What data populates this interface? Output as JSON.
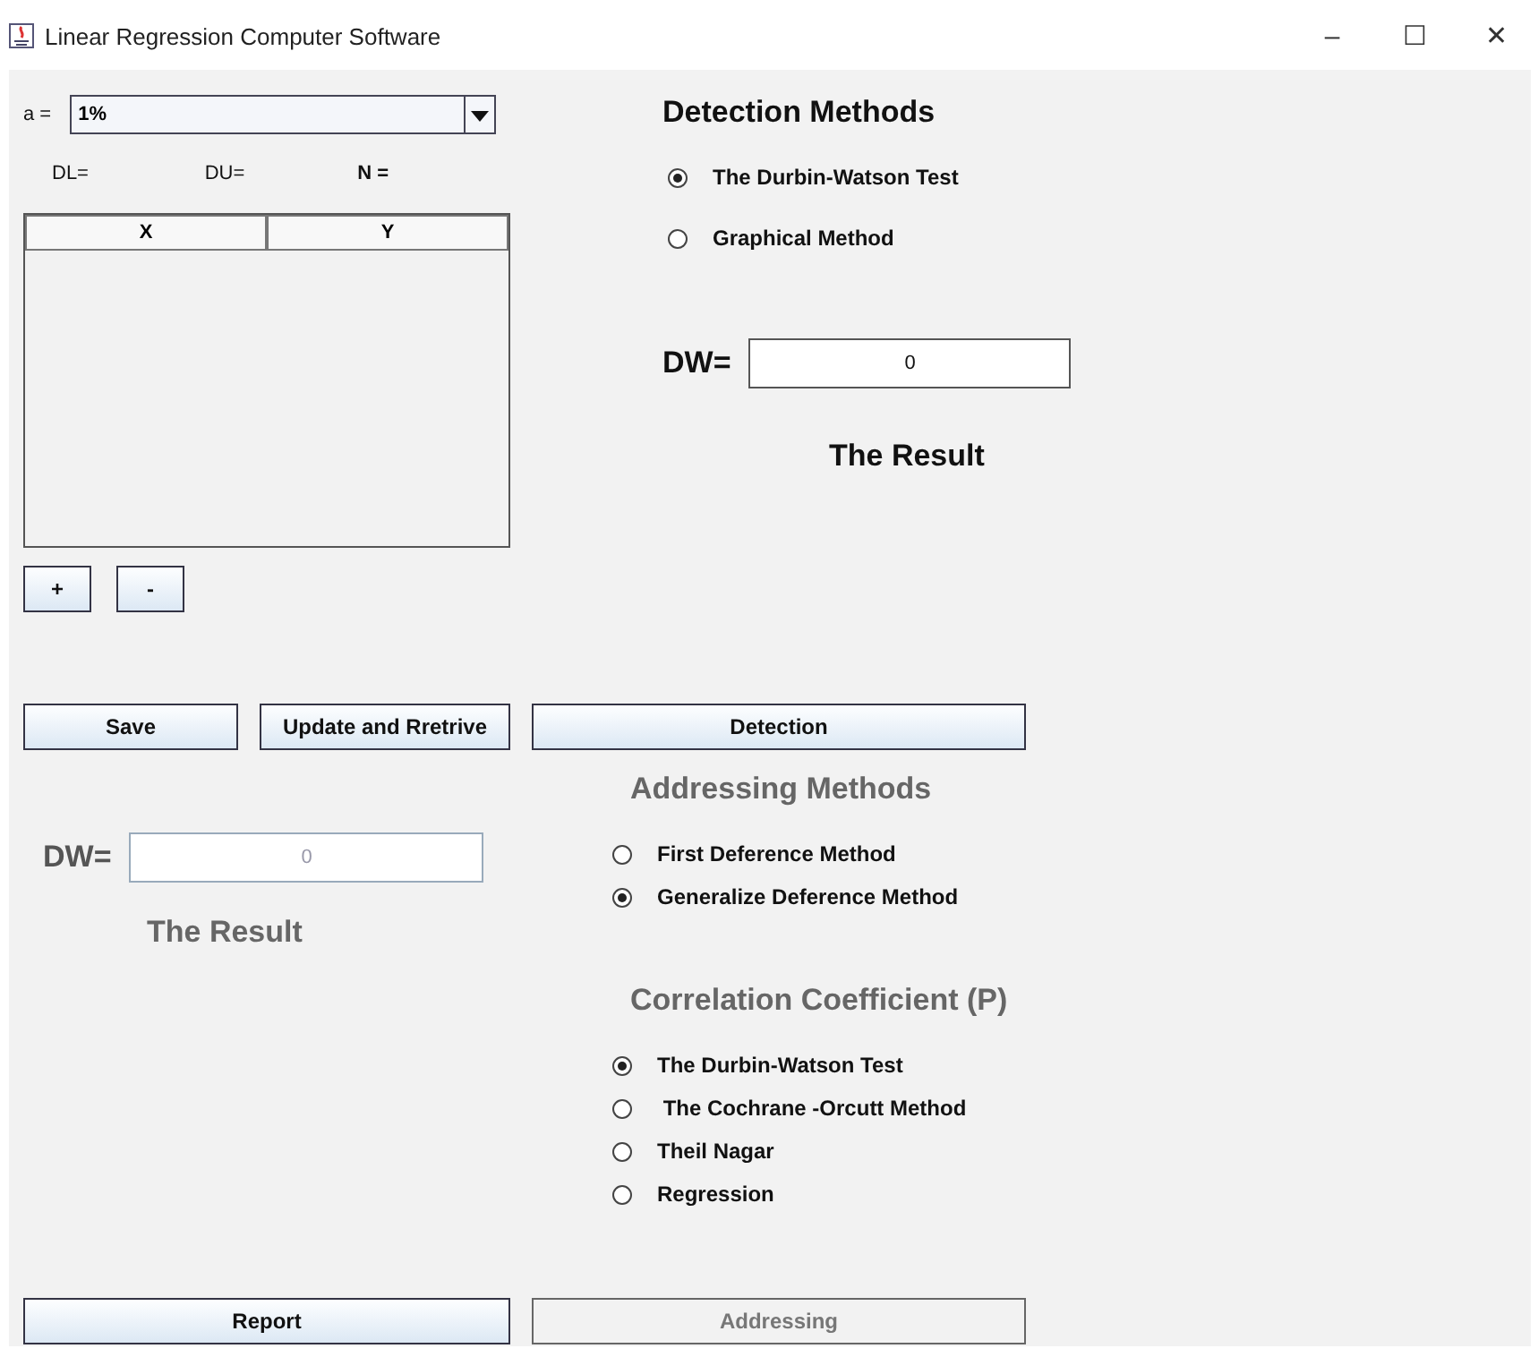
{
  "window": {
    "title": "Linear Regression Computer Software",
    "controls": [
      "–",
      "☐",
      "✕"
    ]
  },
  "alpha": {
    "label": "a =",
    "value": "1%"
  },
  "stats": [
    "DL=",
    "DU=",
    "N ="
  ],
  "table": {
    "columns": [
      "X",
      "Y"
    ]
  },
  "row_buttons": [
    "+",
    "-"
  ],
  "detection": {
    "title": "Detection Methods",
    "options": [
      {
        "label": "The Durbin-Watson Test",
        "selected": true
      },
      {
        "label": "Graphical Method",
        "selected": false
      }
    ],
    "dw_label": "DW=",
    "dw_value": "0",
    "result": "The Result"
  },
  "action_buttons": [
    {
      "label": "Save",
      "disabled": false
    },
    {
      "label": "Update and Rretrive",
      "disabled": false
    },
    {
      "label": "Detection",
      "disabled": false
    }
  ],
  "addressing_result": {
    "dw_label": "DW=",
    "dw_value": "0",
    "result": "The Result",
    "disabled": true
  },
  "addressing": {
    "title": "Addressing Methods",
    "disabled": true,
    "options": [
      {
        "label": "First Deference Method",
        "selected": false
      },
      {
        "label": "Generalize Deference Method",
        "selected": true
      }
    ]
  },
  "correlation": {
    "title": "Correlation Coefficient (P)",
    "disabled": true,
    "options": [
      {
        "label": "The Durbin-Watson Test",
        "selected": true
      },
      {
        "label": " The Cochrane -Orcutt Method",
        "selected": false
      },
      {
        "label": "Theil Nagar",
        "selected": false
      },
      {
        "label": "Regression",
        "selected": false
      }
    ]
  },
  "bottom_buttons": [
    {
      "label": "Report",
      "disabled": false
    },
    {
      "label": "Addressing",
      "disabled": true
    }
  ]
}
